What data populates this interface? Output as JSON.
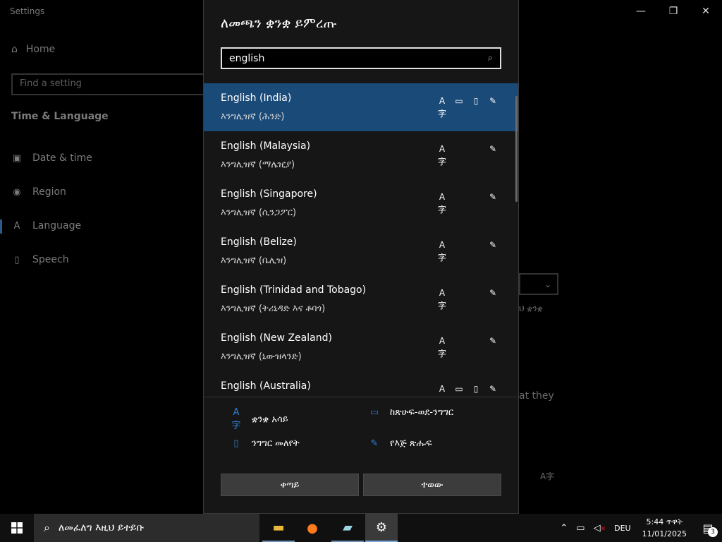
{
  "settings_window": {
    "title": "Settings",
    "controls": {
      "minimize": "—",
      "maximize": "❐",
      "close": "✕"
    },
    "home_label": "Home",
    "search_placeholder": "Find a setting",
    "section_title": "Time & Language",
    "nav_items": [
      {
        "label": "Date & time",
        "icon": "calendar-clock-icon"
      },
      {
        "label": "Region",
        "icon": "globe-icon"
      },
      {
        "label": "Language",
        "icon": "language-icon"
      },
      {
        "label": "Speech",
        "icon": "microphone-icon"
      }
    ],
    "bg_text_1": "ህ ቋንቋ",
    "bg_text_2": "at they"
  },
  "dialog": {
    "title": "ለመጫን ቋንቋ ይምረጡ",
    "search": {
      "value": "english"
    },
    "languages": [
      {
        "name": "English (India)",
        "native": "እንግሊዝኛ (ሕንድ)",
        "selected": true,
        "features": [
          "display",
          "tts",
          "speech",
          "handwriting"
        ]
      },
      {
        "name": "English (Malaysia)",
        "native": "እንግሊዝኛ (ማሌዢያ)",
        "selected": false,
        "features": [
          "display",
          "handwriting"
        ]
      },
      {
        "name": "English (Singapore)",
        "native": "እንግሊዝኛ (ሲንጋፖር)",
        "selected": false,
        "features": [
          "display",
          "handwriting"
        ]
      },
      {
        "name": "English (Belize)",
        "native": "እንግሊዝኛ (ቤሊዝ)",
        "selected": false,
        "features": [
          "display",
          "handwriting"
        ]
      },
      {
        "name": "English (Trinidad and Tobago)",
        "native": "እንግሊዝኛ (ትሪኒዳድ እና ቶባጎ)",
        "selected": false,
        "features": [
          "display",
          "handwriting"
        ]
      },
      {
        "name": "English (New Zealand)",
        "native": "እንግሊዝኛ (ኒውዝላንድ)",
        "selected": false,
        "features": [
          "display",
          "handwriting"
        ]
      },
      {
        "name": "English (Australia)",
        "native": "",
        "selected": false,
        "features": [
          "display",
          "tts",
          "speech",
          "handwriting"
        ]
      }
    ],
    "legend": {
      "display": "ቋንቋ አሳይ",
      "tts": "ከጽሁፍ-ወደ-ንግግር",
      "speech": "ንግግር መለየት",
      "handwriting": "የእጅ ጽሑፍ"
    },
    "next_label": "ቀጣይ",
    "cancel_label": "ተወው"
  },
  "taskbar": {
    "search_placeholder": "ለመፈለግ እዚህ ይተይቡ",
    "apps": [
      {
        "name": "File Explorer",
        "icon": "folder-icon"
      },
      {
        "name": "Firefox",
        "icon": "firefox-icon"
      },
      {
        "name": "Notepad",
        "icon": "notepad-icon"
      },
      {
        "name": "Settings",
        "icon": "gear-icon"
      }
    ],
    "keyboard_layout": "DEU",
    "time": "5:44 ጥዋት",
    "date": "11/01/2025",
    "notification_count": "3"
  }
}
